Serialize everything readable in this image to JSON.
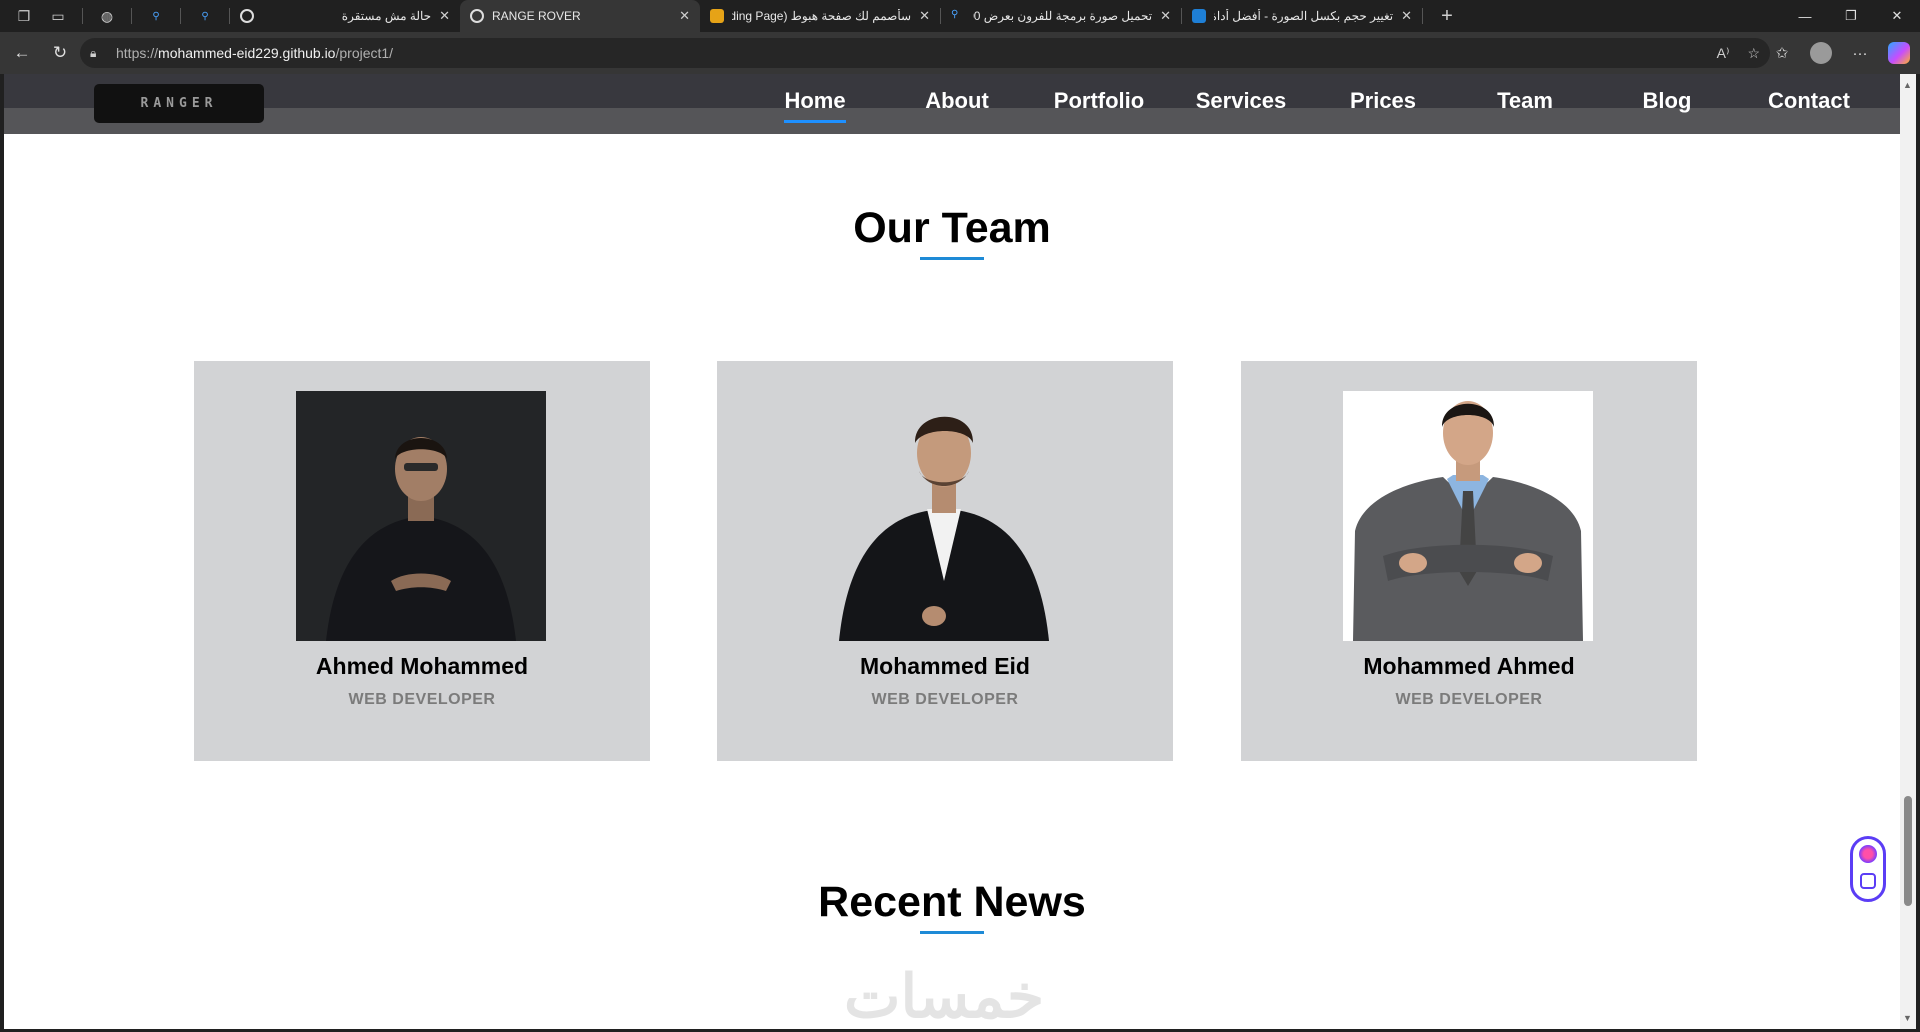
{
  "browser": {
    "tabs": [
      {
        "title": "حالة مش مستقرة",
        "active": false
      },
      {
        "title": "RANGE ROVER",
        "active": true
      },
      {
        "title": "سأصمم لك صفحة هبوط (Landing Page)",
        "active": false
      },
      {
        "title": "تحميل صورة برمجة للفرون بعرض 00",
        "active": false
      },
      {
        "title": "تغيير حجم بكسل الصورة - أفضل أداة",
        "active": false
      }
    ],
    "url_prefix": "https://",
    "url_host": "mohammed-eid229.github.io",
    "url_path": "/project1/",
    "icons": {
      "back": "back-arrow-icon",
      "refresh": "refresh-icon",
      "lock": "lock-icon",
      "read_aloud": "read-aloud-icon",
      "favorite": "star-icon",
      "favorites": "favorites-icon",
      "more": "more-icon"
    }
  },
  "site": {
    "logo_text": "RANGER",
    "nav": [
      {
        "label": "Home",
        "current": true
      },
      {
        "label": "About",
        "current": false
      },
      {
        "label": "Portfolio",
        "current": false
      },
      {
        "label": "Services",
        "current": false
      },
      {
        "label": "Prices",
        "current": false
      },
      {
        "label": "Team",
        "current": false
      },
      {
        "label": "Blog",
        "current": false
      },
      {
        "label": "Contact",
        "current": false
      }
    ],
    "team_title": "Our Team",
    "team": [
      {
        "name": "Ahmed Mohammed",
        "role": "WEB DEVELOPER"
      },
      {
        "name": "Mohammed Eid",
        "role": "WEB DEVELOPER"
      },
      {
        "name": "Mohammed Ahmed",
        "role": "WEB DEVELOPER"
      }
    ],
    "news_title": "Recent News",
    "watermark": "خمسات",
    "colors": {
      "accent": "#1e8ad6",
      "card_bg": "#d2d3d5",
      "header_bg": "#38383e"
    }
  }
}
